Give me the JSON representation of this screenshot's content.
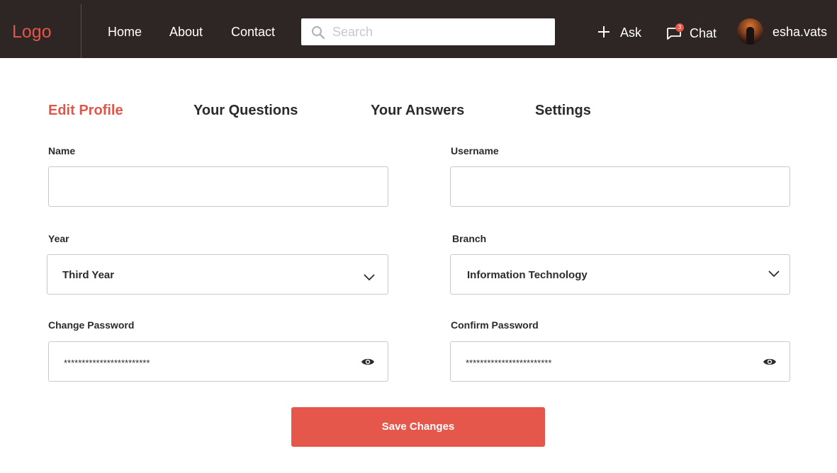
{
  "header": {
    "logo": "Logo",
    "nav": [
      {
        "label": "Home"
      },
      {
        "label": "About"
      },
      {
        "label": "Contact"
      }
    ],
    "search": {
      "placeholder": "Search",
      "value": ""
    },
    "ask_label": "Ask",
    "chat_label": "Chat",
    "chat_badge": "3",
    "username": "esha.vats"
  },
  "tabs": [
    {
      "label": "Edit Profile",
      "active": true
    },
    {
      "label": "Your Questions",
      "active": false
    },
    {
      "label": "Your Answers",
      "active": false
    },
    {
      "label": "Settings",
      "active": false
    }
  ],
  "form": {
    "name": {
      "label": "Name",
      "value": ""
    },
    "username": {
      "label": "Username",
      "value": ""
    },
    "year": {
      "label": "Year",
      "value": "Third Year"
    },
    "branch": {
      "label": "Branch",
      "value": "Information Technology"
    },
    "change_password": {
      "label": "Change Password",
      "value": "************************"
    },
    "confirm_password": {
      "label": "Confirm Password",
      "value": "************************"
    },
    "save_label": "Save Changes"
  },
  "colors": {
    "accent": "#e15649",
    "topbar": "#2e2624",
    "button": "#e5564b"
  },
  "icons": {
    "search": "search-icon",
    "ask": "plus-icon",
    "chat": "chat-bubble-icon",
    "select": "chevron-down-icon",
    "password": "eye-icon"
  }
}
